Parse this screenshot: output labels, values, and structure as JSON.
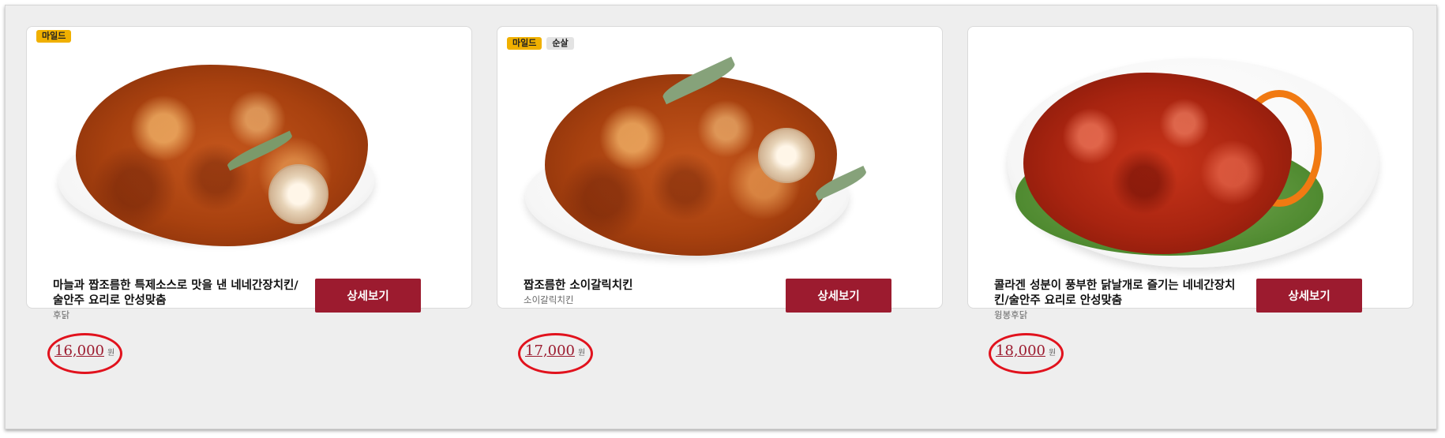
{
  "products": [
    {
      "badges": [
        "마일드"
      ],
      "name": "마늘과 짭조름한 특제소스로 맛을 낸 네네간장치킨/술안주 요리로 안성맞춤",
      "sub": "후닭",
      "button": "상세보기",
      "price": "16,000",
      "currency": "원",
      "image": "garlic-soy-chicken"
    },
    {
      "badges": [
        "마일드",
        "순살"
      ],
      "name": "짭조름한 소이갈릭치킨",
      "sub": "소이갈릭치킨",
      "button": "상세보기",
      "price": "17,000",
      "currency": "원",
      "image": "soy-garlic-chicken"
    },
    {
      "badges": [],
      "name": "콜라겐 성분이 풍부한 닭날개로 즐기는 네네간장치킨/술안주 요리로 안성맞춤",
      "sub": "윙봉후닭",
      "button": "상세보기",
      "price": "18,000",
      "currency": "원",
      "image": "spicy-chicken-wings"
    }
  ],
  "colors": {
    "accent": "#9c1b2f",
    "mild_badge": "#f0b000",
    "highlight_circle": "#e1121d"
  }
}
